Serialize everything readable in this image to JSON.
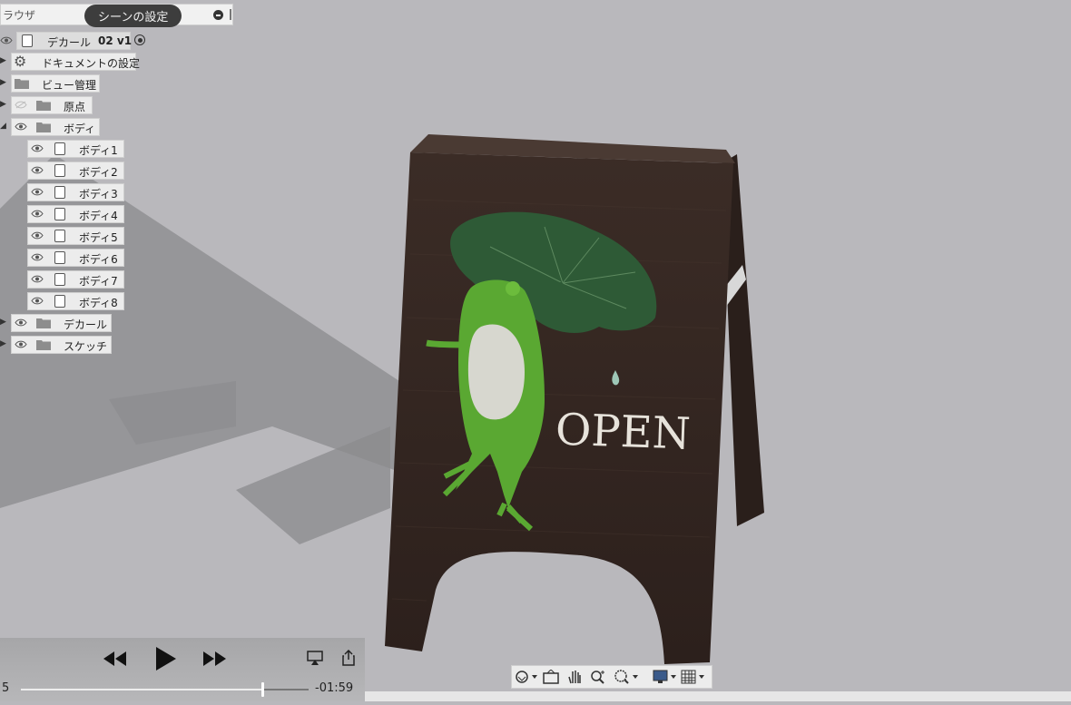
{
  "browser": {
    "title": "ラウザ",
    "tooltip": "シーンの設定",
    "root": {
      "name": "デカール",
      "version": "02 v1"
    },
    "nodes": [
      {
        "label": "ドキュメントの設定",
        "icon": "gear-icon"
      },
      {
        "label": "ビュー管理",
        "icon": "folder-icon"
      },
      {
        "label": "原点",
        "icon": "folder-icon"
      },
      {
        "label": "ボディ",
        "icon": "folder-icon"
      }
    ],
    "bodies": [
      "ボディ1",
      "ボディ2",
      "ボディ3",
      "ボディ4",
      "ボディ5",
      "ボディ6",
      "ボディ7",
      "ボディ8"
    ],
    "folders_after": [
      "デカール",
      "スケッチ"
    ]
  },
  "sign": {
    "text": "OPEN"
  },
  "player": {
    "elapsed": "5",
    "remaining": "-01:59",
    "progress": 0.84
  },
  "colors": {
    "background": "#b9b8bc",
    "wood": "#3a2b25",
    "leaf": "#2f5a37",
    "frog": "#5aa832"
  },
  "navbar": {
    "tools": [
      "orbit-icon",
      "look-at-icon",
      "pan-icon",
      "zoom-icon",
      "zoom-window-icon",
      "display-settings-icon",
      "grid-settings-icon"
    ]
  }
}
